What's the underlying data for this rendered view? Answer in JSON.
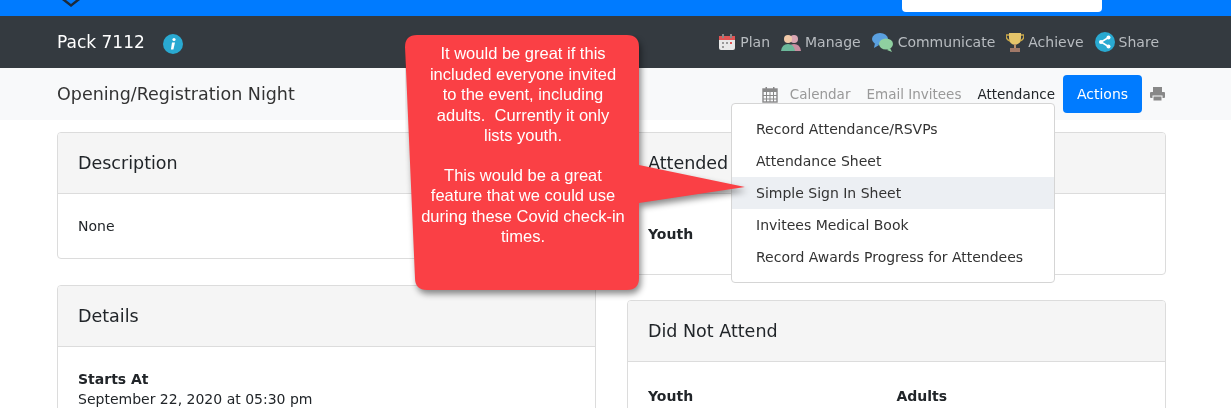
{
  "unit_bar": {
    "name": "Pack 7112"
  },
  "nav": [
    {
      "kind": "plan",
      "label": "Plan"
    },
    {
      "kind": "manage",
      "label": "Manage"
    },
    {
      "kind": "communicate",
      "label": "Communicate"
    },
    {
      "kind": "achieve",
      "label": "Achieve"
    },
    {
      "kind": "share",
      "label": "Share"
    }
  ],
  "event_bar": {
    "title": "Opening/Registration Night",
    "links": [
      {
        "label": "Calendar",
        "selected": false
      },
      {
        "label": "Email Invitees",
        "selected": false
      },
      {
        "label": "Attendance",
        "selected": true
      }
    ],
    "actions_button": "Actions"
  },
  "attendance_menu": [
    {
      "label": "Record Attendance/RSVPs",
      "highlighted": false
    },
    {
      "label": "Attendance Sheet",
      "highlighted": false
    },
    {
      "label": "Simple Sign In Sheet",
      "highlighted": true
    },
    {
      "label": "Invitees Medical Book",
      "highlighted": false
    },
    {
      "label": "Record Awards Progress for Attendees",
      "highlighted": false
    }
  ],
  "cards": {
    "description": {
      "title": "Description",
      "text": "None"
    },
    "details": {
      "title": "Details",
      "label": "Starts At",
      "value": "September 22, 2020 at 05:30 pm"
    },
    "attended": {
      "title": "Attended",
      "columns": [
        "Youth"
      ]
    },
    "did_not_attend": {
      "title": "Did Not Attend",
      "columns": [
        "Youth",
        "Adults"
      ]
    }
  },
  "callout": {
    "paragraphs": [
      "It would be great if this included everyone invited to the event, including adults.  Currently it only lists youth.",
      "This would be a great feature that we could use during these Covid check-in times."
    ]
  }
}
